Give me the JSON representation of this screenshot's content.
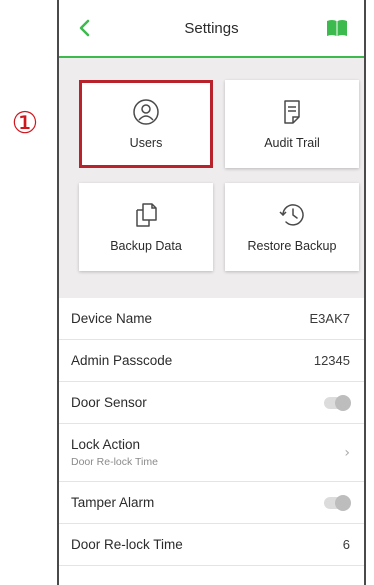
{
  "annotation": {
    "marker": "①"
  },
  "header": {
    "title": "Settings",
    "back_icon": "chevron-left-icon",
    "help_icon": "book-icon",
    "accent": "#3dba4e"
  },
  "tiles": [
    {
      "label": "Users",
      "icon": "user-icon",
      "highlighted": true
    },
    {
      "label": "Audit Trail",
      "icon": "document-icon"
    },
    {
      "label": "Backup Data",
      "icon": "copy-document-icon"
    },
    {
      "label": "Restore Backup",
      "icon": "history-clock-icon"
    }
  ],
  "rows": [
    {
      "label": "Device Name",
      "value": "E3AK7"
    },
    {
      "label": "Admin Passcode",
      "value": "12345"
    },
    {
      "label": "Door Sensor",
      "toggle": false
    },
    {
      "label": "Lock Action",
      "sublabel": "Door Re-lock Time",
      "chevron": "›"
    },
    {
      "label": "Tamper Alarm",
      "toggle": false
    },
    {
      "label": "Door Re-lock Time",
      "value": "6"
    }
  ]
}
